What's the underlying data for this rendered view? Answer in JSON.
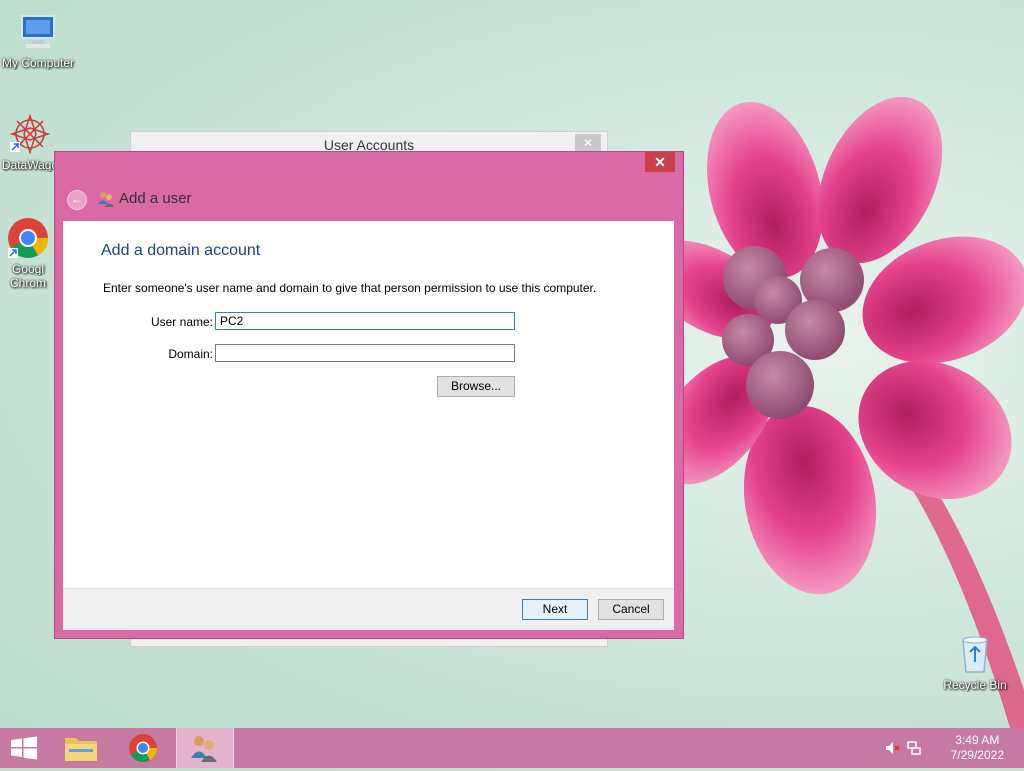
{
  "desktop": {
    "icons": [
      {
        "label": "My Computer"
      },
      {
        "label": "DataWago"
      },
      {
        "label": "Googl",
        "label2": "Chrom"
      },
      {
        "label": "Recycle Bin"
      }
    ]
  },
  "background_window": {
    "title": "User Accounts",
    "close_glyph": "✕"
  },
  "dialog": {
    "close_glyph": "✕",
    "back_glyph": "←",
    "header_title": "Add a user",
    "heading": "Add a domain account",
    "description": "Enter someone's user name and domain to give that person permission to use this computer.",
    "username_label": "User name:",
    "username_value": "PC2",
    "domain_label": "Domain:",
    "domain_value": "",
    "browse_label": "Browse...",
    "next_label": "Next",
    "cancel_label": "Cancel"
  },
  "taskbar": {
    "clock_time": "3:49 AM",
    "clock_date": "7/29/2022"
  },
  "colors": {
    "dialog_frame": "#d96aa4",
    "taskbar": "#c77aa1",
    "heading": "#1e3f8a"
  }
}
